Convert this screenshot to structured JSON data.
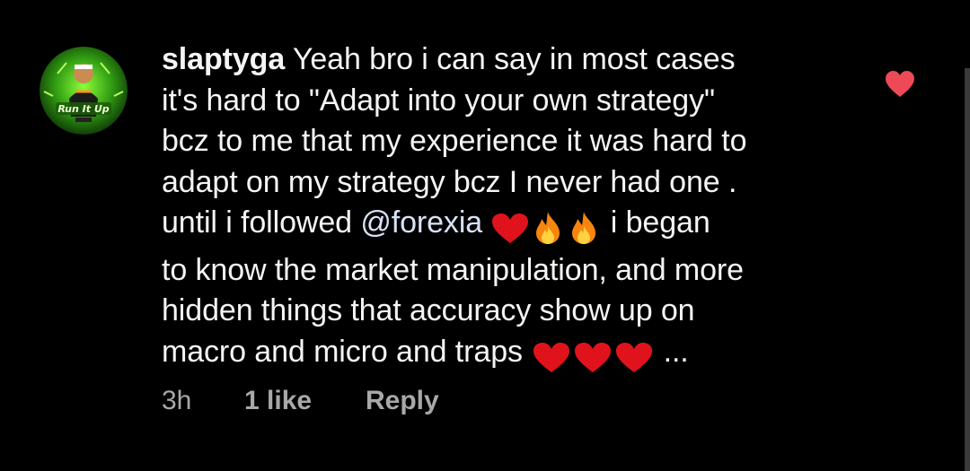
{
  "avatar": {
    "badge_text": "Run It Up",
    "accent_color": "#5fdc2a"
  },
  "comment": {
    "username": "slaptyga",
    "lines": [
      " Yeah bro i can say in most cases",
      "it's hard to \"Adapt into your own strategy\"",
      "bcz to me that my experience it was hard to",
      "adapt on my strategy bcz I never had one .",
      "until i followed ",
      "@forexia",
      " i began",
      "to know the market manipulation, and more",
      "hidden things that accuracy show up on",
      "macro and micro and traps ",
      " ..."
    ],
    "emojis": {
      "heart": "red-heart",
      "fire": "fire"
    }
  },
  "meta": {
    "time": "3h",
    "likes": "1 like",
    "reply": "Reply"
  },
  "like_button": {
    "icon": "heart-icon",
    "state": "liked",
    "color": "#ed4956"
  }
}
